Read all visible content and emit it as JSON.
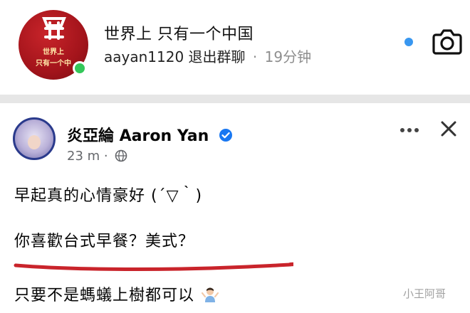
{
  "dm": {
    "avatar_text_line1": "世界上",
    "avatar_text_line2": "只有一个中",
    "chat_name": "世界上 只有一个中国",
    "username": "aayan1120",
    "action": "退出群聊",
    "separator": "·",
    "time_ago": "19分钟",
    "icons": [
      "online-status-dot",
      "unread-indicator-dot",
      "camera-icon"
    ],
    "colors": {
      "online": "#34c759",
      "unread": "#3897f0"
    }
  },
  "post": {
    "author": "炎亞綸 Aaron Yan",
    "time_ago": "23 m",
    "meta_separator": "·",
    "lines": [
      "早起真的心情豪好 (´▽｀)",
      "你喜歡台式早餐？美式？",
      "只要不是螞蟻上樹都可以"
    ],
    "icons": [
      "verified-badge-icon",
      "globe-icon",
      "more-options-icon",
      "close-icon",
      "shrug-emoji"
    ],
    "colors": {
      "underline": "#c9242b",
      "verified": "#1877f2"
    }
  },
  "watermark": "小王阿哥"
}
